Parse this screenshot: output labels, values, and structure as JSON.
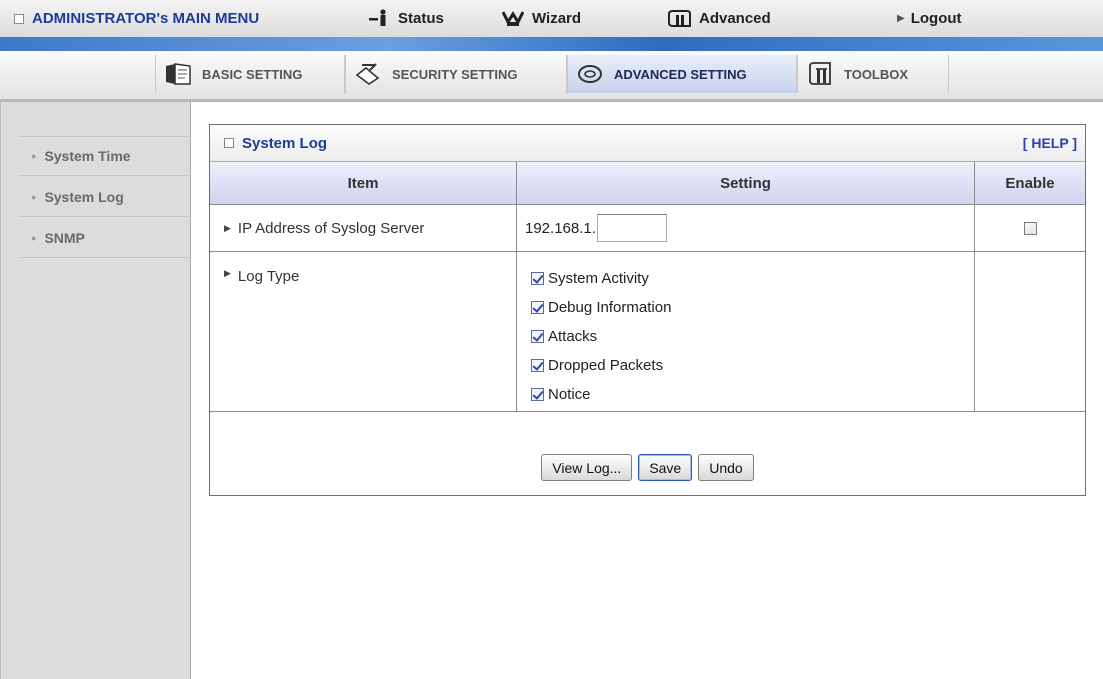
{
  "topbar": {
    "admin_menu": "ADMINISTRATOR's MAIN MENU",
    "status": "Status",
    "wizard": "Wizard",
    "advanced": "Advanced",
    "logout": "Logout"
  },
  "nav": {
    "tabs": [
      {
        "label": "BASIC SETTING",
        "icon": "folder-icon"
      },
      {
        "label": "SECURITY SETTING",
        "icon": "lock-pen-icon"
      },
      {
        "label": "ADVANCED SETTING",
        "icon": "disc-icon",
        "active": true
      },
      {
        "label": "TOOLBOX",
        "icon": "toolbox-icon"
      }
    ]
  },
  "sidebar": {
    "items": [
      {
        "label": "System Time"
      },
      {
        "label": "System Log"
      },
      {
        "label": "SNMP"
      }
    ]
  },
  "panel": {
    "title": "System Log",
    "help": "[ HELP ]",
    "columns": [
      "Item",
      "Setting",
      "Enable"
    ],
    "ip_row": {
      "label": "IP Address of Syslog Server",
      "prefix": "192.168.1.",
      "value": "",
      "enabled": false
    },
    "log_type": {
      "label": "Log Type",
      "options": [
        {
          "label": "System Activity",
          "checked": true
        },
        {
          "label": "Debug Information",
          "checked": true
        },
        {
          "label": "Attacks",
          "checked": true
        },
        {
          "label": "Dropped Packets",
          "checked": true
        },
        {
          "label": "Notice",
          "checked": true
        }
      ]
    },
    "buttons": {
      "view_log": "View Log...",
      "save": "Save",
      "undo": "Undo"
    }
  },
  "colors": {
    "title_blue": "#1f3a99",
    "sidebar_bg": "#dcdcdc",
    "header_bg": "#cfd3ef",
    "blue_strip": "#3f78c9"
  }
}
